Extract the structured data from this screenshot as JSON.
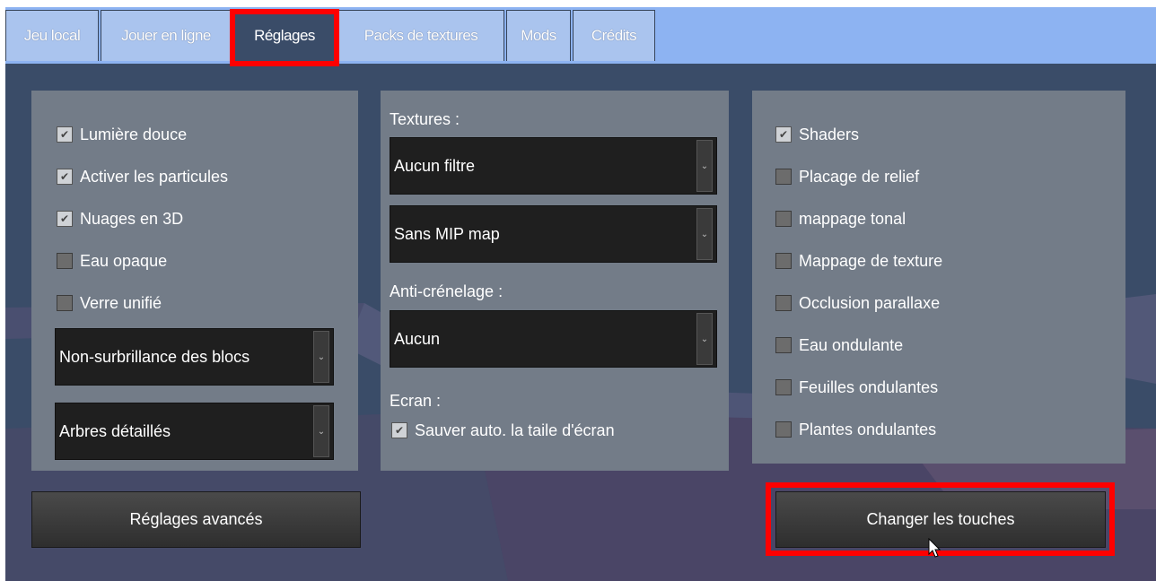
{
  "tabs": [
    {
      "label": "Jeu local"
    },
    {
      "label": "Jouer en ligne"
    },
    {
      "label": "Réglages"
    },
    {
      "label": "Packs de textures"
    },
    {
      "label": "Mods"
    },
    {
      "label": "Crédits"
    }
  ],
  "active_tab": "Réglages",
  "left_panel": {
    "checkboxes": [
      {
        "label": "Lumière douce",
        "checked": true
      },
      {
        "label": "Activer les particules",
        "checked": true
      },
      {
        "label": "Nuages en 3D",
        "checked": true
      },
      {
        "label": "Eau opaque",
        "checked": false
      },
      {
        "label": "Verre unifié",
        "checked": false
      }
    ],
    "dropdowns": [
      {
        "value": "Non-surbrillance des blocs"
      },
      {
        "value": "Arbres détaillés"
      }
    ]
  },
  "middle_panel": {
    "textures_label": "Textures :",
    "texture_filter": "Aucun filtre",
    "mipmap": "Sans MIP map",
    "antialiasing_label": "Anti-crénelage :",
    "antialiasing": "Aucun",
    "screen_label": "Ecran :",
    "autosave_screen": {
      "label": "Sauver auto. la taile d'écran",
      "checked": true
    }
  },
  "right_panel": {
    "checkboxes": [
      {
        "label": "Shaders",
        "checked": true
      },
      {
        "label": "Placage de relief",
        "checked": false
      },
      {
        "label": "mappage tonal",
        "checked": false
      },
      {
        "label": "Mappage de texture",
        "checked": false
      },
      {
        "label": "Occlusion parallaxe",
        "checked": false
      },
      {
        "label": "Eau ondulante",
        "checked": false
      },
      {
        "label": "Feuilles ondulantes",
        "checked": false
      },
      {
        "label": "Plantes ondulantes",
        "checked": false
      }
    ]
  },
  "buttons": {
    "advanced_settings": "Réglages avancés",
    "change_keys": "Changer les touches"
  },
  "colors": {
    "highlight": "#ff0000",
    "tabbar": "#8db3f2",
    "background": "#3a4c68",
    "panel": "#737c88"
  },
  "icons": {
    "checkbox_checked": "checkmark-icon",
    "dropdown_arrow": "chevron-down-icon",
    "mouse": "cursor-icon"
  }
}
